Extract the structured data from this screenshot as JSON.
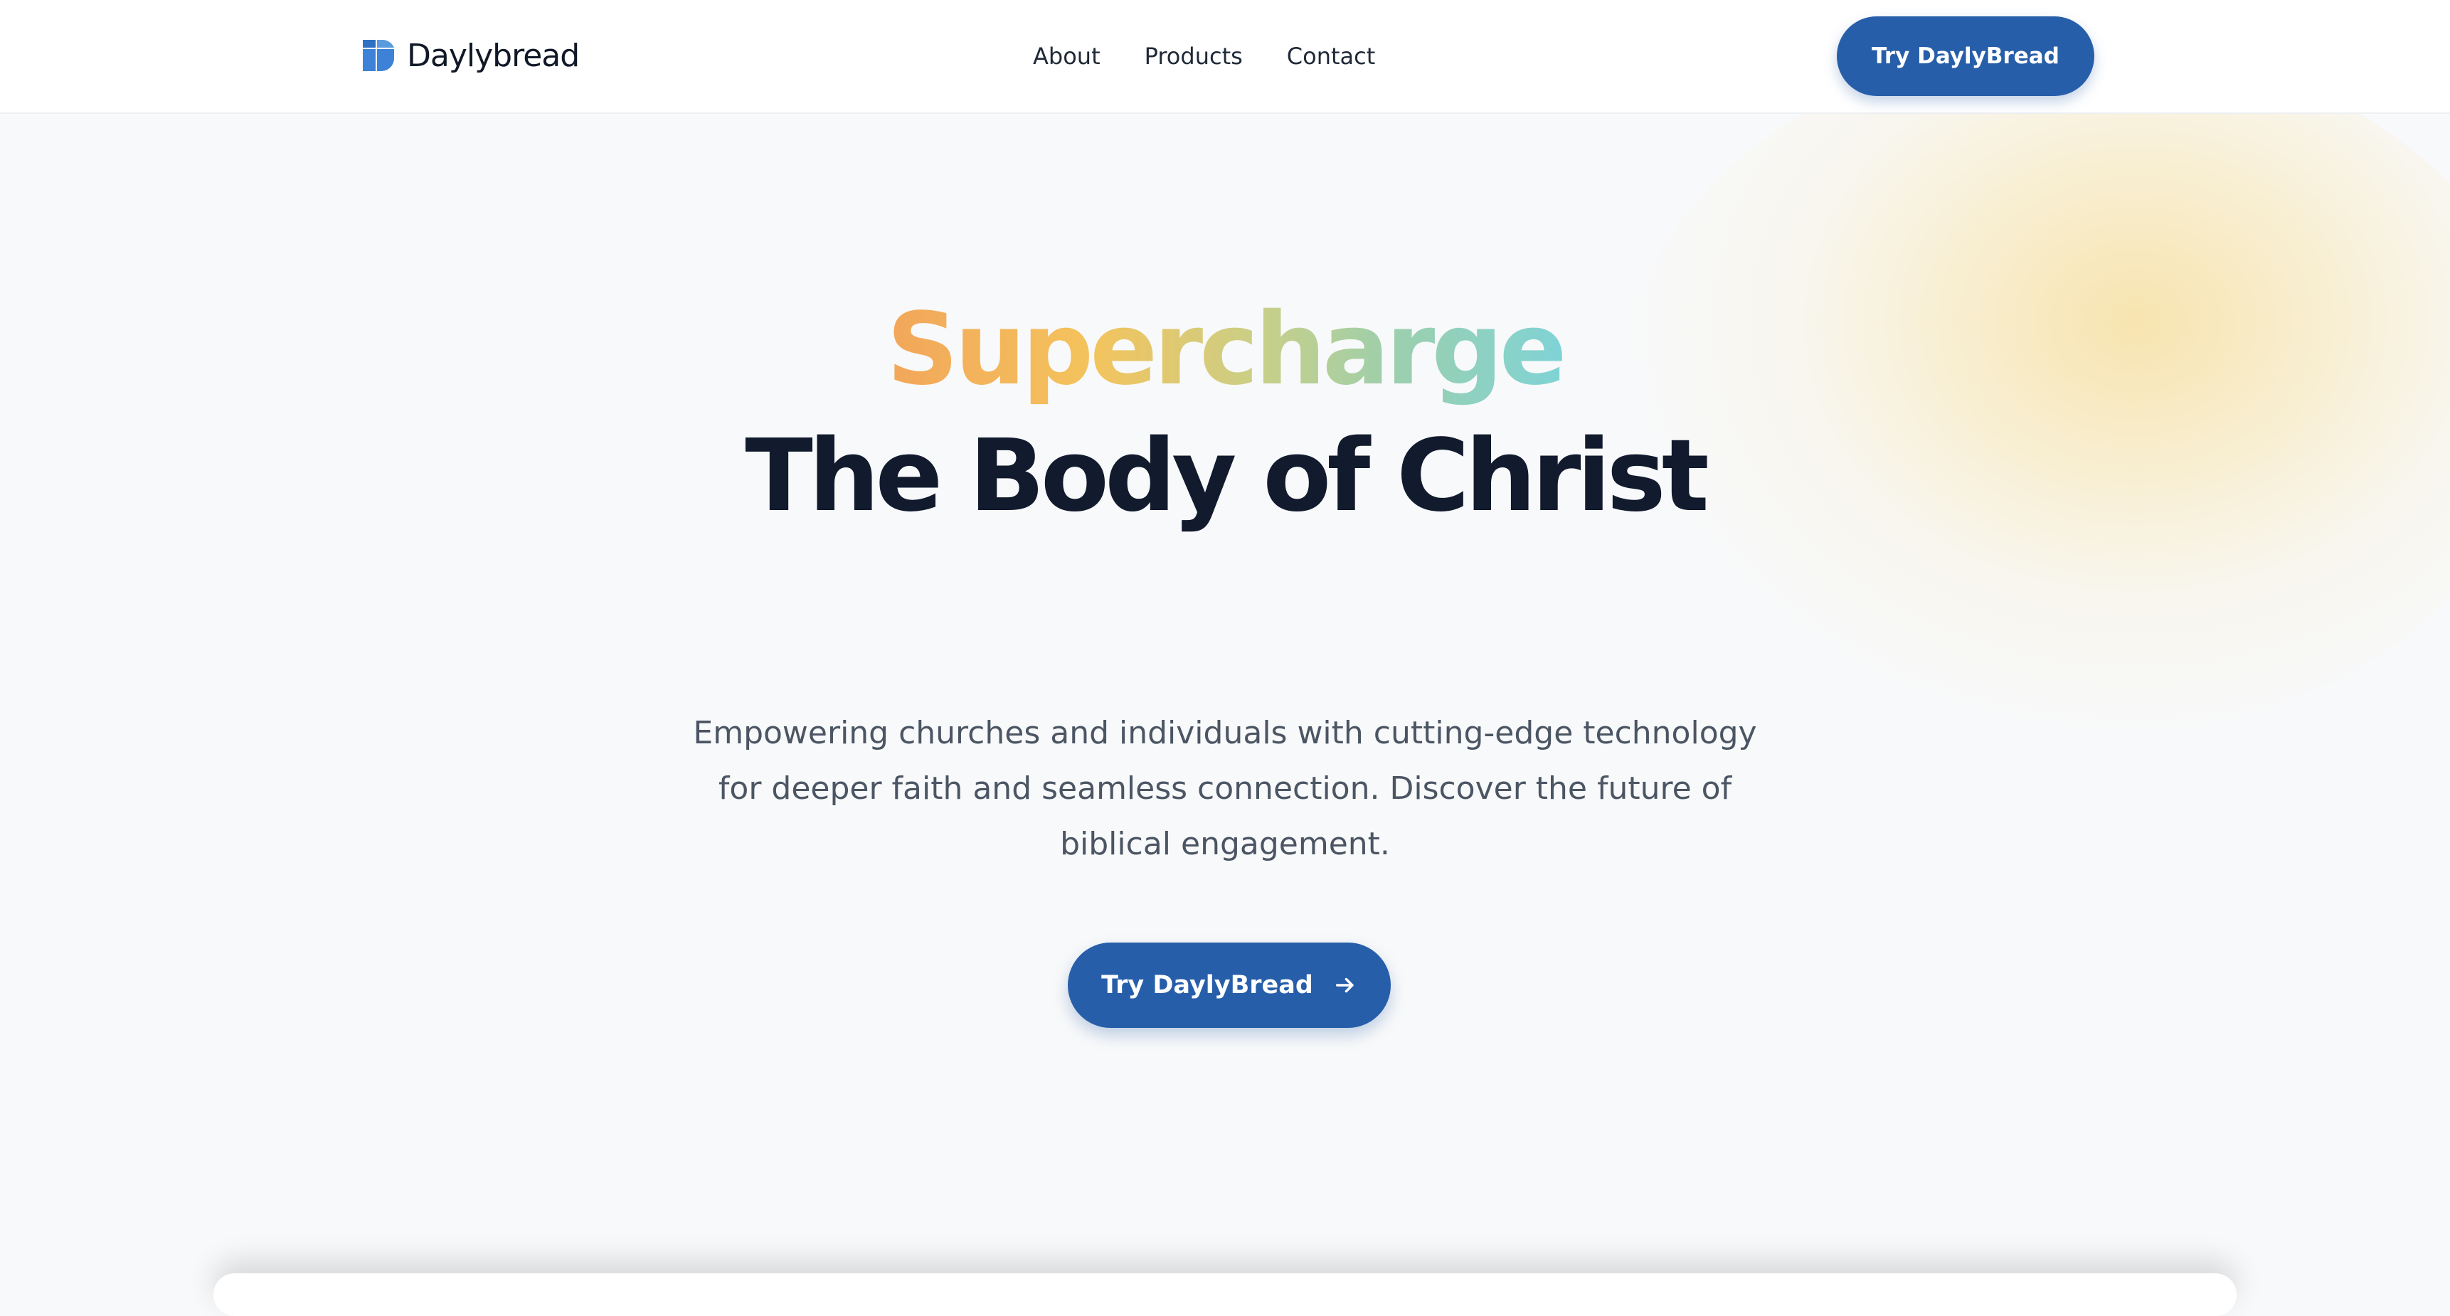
{
  "header": {
    "logo_text": "Daylybread",
    "logo_icon": "daylybread-logo-icon",
    "nav": [
      {
        "label": "About"
      },
      {
        "label": "Products"
      },
      {
        "label": "Contact"
      }
    ],
    "cta_label": "Try DaylyBread"
  },
  "hero": {
    "title_gradient": "Supercharge",
    "title_main": "The Body of Christ",
    "subtitle": "Empowering churches and individuals with cutting-edge technology for deeper faith and seamless connection. Discover the future of biblical engagement.",
    "cta_label": "Try DaylyBread",
    "cta_icon": "arrow-right-icon"
  },
  "colors": {
    "primary": "#275ea9",
    "text_dark": "#121a2e",
    "text_muted": "#4b5563",
    "background": "#f8f9fa",
    "glow": "#f7e0a2",
    "gradient_start": "#f2a65a",
    "gradient_end": "#7fd3d6"
  }
}
